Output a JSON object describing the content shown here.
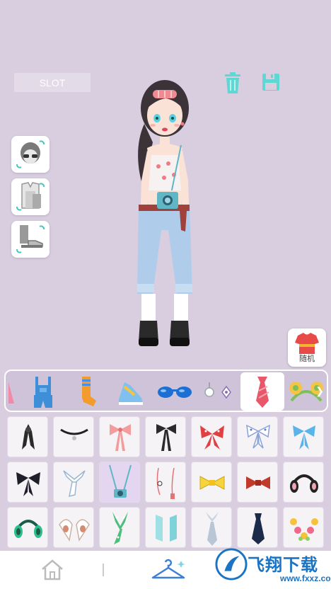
{
  "header": {
    "slot_label": "SLOT",
    "trash_icon": "trash-icon",
    "save_icon": "save-icon"
  },
  "side_buttons": [
    {
      "name": "hairstyle-swap",
      "icon": "head-with-glasses-icon"
    },
    {
      "name": "top-swap",
      "icon": "shirt-icon"
    },
    {
      "name": "shoes-swap",
      "icon": "boots-icon"
    }
  ],
  "random": {
    "label": "随机",
    "icon": "tshirt-icon"
  },
  "categories": [
    {
      "icon": "partial-icon"
    },
    {
      "icon": "overalls-icon"
    },
    {
      "icon": "sock-icon"
    },
    {
      "icon": "sneaker-icon"
    },
    {
      "icon": "sunglasses-icon"
    },
    {
      "icon": "earrings-icon"
    },
    {
      "icon": "necktie-icon",
      "active": true
    },
    {
      "icon": "bear-ears-icon"
    }
  ],
  "items": [
    {
      "icon": "black-ribbon-icon"
    },
    {
      "icon": "choker-icon"
    },
    {
      "icon": "pink-bow-tie-icon"
    },
    {
      "icon": "black-bow-tie-icon"
    },
    {
      "icon": "red-scarf-bow-icon"
    },
    {
      "icon": "dotted-bow-icon"
    },
    {
      "icon": "blue-bow-icon"
    },
    {
      "icon": "black-bow-icon"
    },
    {
      "icon": "white-scarf-icon"
    },
    {
      "icon": "camera-strap-icon",
      "selected": true
    },
    {
      "icon": "earphones-icon"
    },
    {
      "icon": "yellow-bow-tie-icon"
    },
    {
      "icon": "red-bow-tie-icon"
    },
    {
      "icon": "black-headphones-icon"
    },
    {
      "icon": "green-headphones-icon"
    },
    {
      "icon": "cow-ears-icon"
    },
    {
      "icon": "green-scarf-icon"
    },
    {
      "icon": "mint-scarf-icon"
    },
    {
      "icon": "grey-tie-icon"
    },
    {
      "icon": "navy-tie-icon"
    },
    {
      "icon": "flower-lei-icon"
    }
  ],
  "nav": {
    "home": "home-icon",
    "closet": "hanger-icon"
  },
  "watermark": {
    "text": "飞翔下载",
    "url": "www.fxxz.com"
  },
  "colors": {
    "background": "#d9cde0",
    "accent": "#3d7fd6",
    "teal": "#43c8c3"
  }
}
